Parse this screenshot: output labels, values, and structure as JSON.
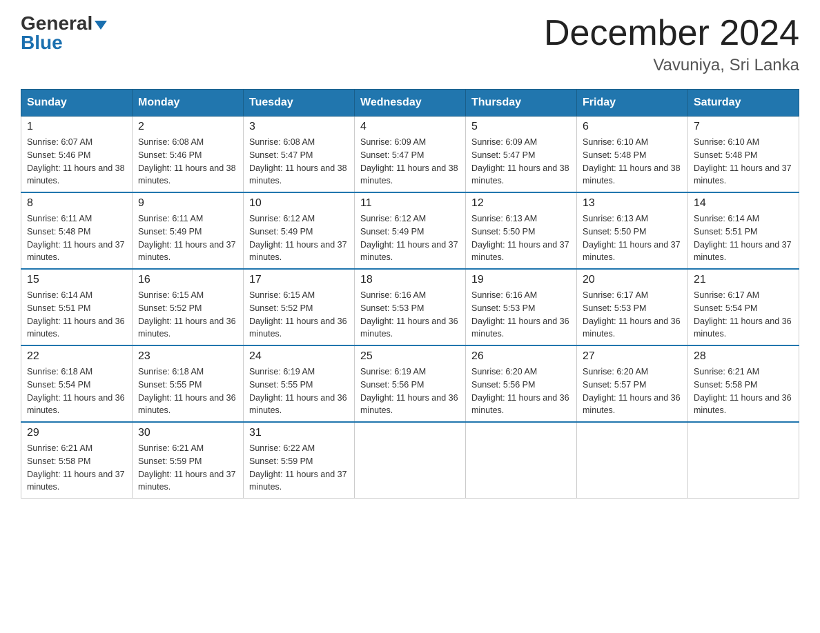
{
  "logo": {
    "general": "General",
    "blue": "Blue",
    "triangle": "▼"
  },
  "title": {
    "month": "December 2024",
    "location": "Vavuniya, Sri Lanka"
  },
  "headers": [
    "Sunday",
    "Monday",
    "Tuesday",
    "Wednesday",
    "Thursday",
    "Friday",
    "Saturday"
  ],
  "weeks": [
    [
      {
        "day": "1",
        "sunrise": "6:07 AM",
        "sunset": "5:46 PM",
        "daylight": "11 hours and 38 minutes."
      },
      {
        "day": "2",
        "sunrise": "6:08 AM",
        "sunset": "5:46 PM",
        "daylight": "11 hours and 38 minutes."
      },
      {
        "day": "3",
        "sunrise": "6:08 AM",
        "sunset": "5:47 PM",
        "daylight": "11 hours and 38 minutes."
      },
      {
        "day": "4",
        "sunrise": "6:09 AM",
        "sunset": "5:47 PM",
        "daylight": "11 hours and 38 minutes."
      },
      {
        "day": "5",
        "sunrise": "6:09 AM",
        "sunset": "5:47 PM",
        "daylight": "11 hours and 38 minutes."
      },
      {
        "day": "6",
        "sunrise": "6:10 AM",
        "sunset": "5:48 PM",
        "daylight": "11 hours and 38 minutes."
      },
      {
        "day": "7",
        "sunrise": "6:10 AM",
        "sunset": "5:48 PM",
        "daylight": "11 hours and 37 minutes."
      }
    ],
    [
      {
        "day": "8",
        "sunrise": "6:11 AM",
        "sunset": "5:48 PM",
        "daylight": "11 hours and 37 minutes."
      },
      {
        "day": "9",
        "sunrise": "6:11 AM",
        "sunset": "5:49 PM",
        "daylight": "11 hours and 37 minutes."
      },
      {
        "day": "10",
        "sunrise": "6:12 AM",
        "sunset": "5:49 PM",
        "daylight": "11 hours and 37 minutes."
      },
      {
        "day": "11",
        "sunrise": "6:12 AM",
        "sunset": "5:49 PM",
        "daylight": "11 hours and 37 minutes."
      },
      {
        "day": "12",
        "sunrise": "6:13 AM",
        "sunset": "5:50 PM",
        "daylight": "11 hours and 37 minutes."
      },
      {
        "day": "13",
        "sunrise": "6:13 AM",
        "sunset": "5:50 PM",
        "daylight": "11 hours and 37 minutes."
      },
      {
        "day": "14",
        "sunrise": "6:14 AM",
        "sunset": "5:51 PM",
        "daylight": "11 hours and 37 minutes."
      }
    ],
    [
      {
        "day": "15",
        "sunrise": "6:14 AM",
        "sunset": "5:51 PM",
        "daylight": "11 hours and 36 minutes."
      },
      {
        "day": "16",
        "sunrise": "6:15 AM",
        "sunset": "5:52 PM",
        "daylight": "11 hours and 36 minutes."
      },
      {
        "day": "17",
        "sunrise": "6:15 AM",
        "sunset": "5:52 PM",
        "daylight": "11 hours and 36 minutes."
      },
      {
        "day": "18",
        "sunrise": "6:16 AM",
        "sunset": "5:53 PM",
        "daylight": "11 hours and 36 minutes."
      },
      {
        "day": "19",
        "sunrise": "6:16 AM",
        "sunset": "5:53 PM",
        "daylight": "11 hours and 36 minutes."
      },
      {
        "day": "20",
        "sunrise": "6:17 AM",
        "sunset": "5:53 PM",
        "daylight": "11 hours and 36 minutes."
      },
      {
        "day": "21",
        "sunrise": "6:17 AM",
        "sunset": "5:54 PM",
        "daylight": "11 hours and 36 minutes."
      }
    ],
    [
      {
        "day": "22",
        "sunrise": "6:18 AM",
        "sunset": "5:54 PM",
        "daylight": "11 hours and 36 minutes."
      },
      {
        "day": "23",
        "sunrise": "6:18 AM",
        "sunset": "5:55 PM",
        "daylight": "11 hours and 36 minutes."
      },
      {
        "day": "24",
        "sunrise": "6:19 AM",
        "sunset": "5:55 PM",
        "daylight": "11 hours and 36 minutes."
      },
      {
        "day": "25",
        "sunrise": "6:19 AM",
        "sunset": "5:56 PM",
        "daylight": "11 hours and 36 minutes."
      },
      {
        "day": "26",
        "sunrise": "6:20 AM",
        "sunset": "5:56 PM",
        "daylight": "11 hours and 36 minutes."
      },
      {
        "day": "27",
        "sunrise": "6:20 AM",
        "sunset": "5:57 PM",
        "daylight": "11 hours and 36 minutes."
      },
      {
        "day": "28",
        "sunrise": "6:21 AM",
        "sunset": "5:58 PM",
        "daylight": "11 hours and 36 minutes."
      }
    ],
    [
      {
        "day": "29",
        "sunrise": "6:21 AM",
        "sunset": "5:58 PM",
        "daylight": "11 hours and 37 minutes."
      },
      {
        "day": "30",
        "sunrise": "6:21 AM",
        "sunset": "5:59 PM",
        "daylight": "11 hours and 37 minutes."
      },
      {
        "day": "31",
        "sunrise": "6:22 AM",
        "sunset": "5:59 PM",
        "daylight": "11 hours and 37 minutes."
      },
      null,
      null,
      null,
      null
    ]
  ]
}
